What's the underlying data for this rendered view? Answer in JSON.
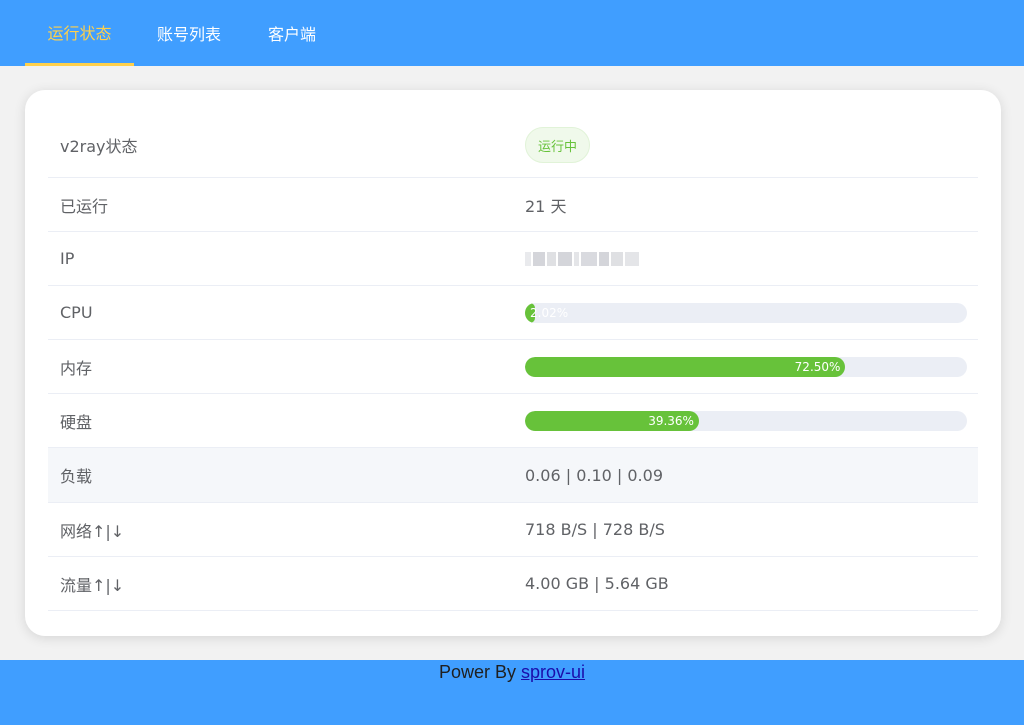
{
  "nav": {
    "items": [
      {
        "label": "运行状态"
      },
      {
        "label": "账号列表"
      },
      {
        "label": "客户端"
      }
    ],
    "active_index": 0
  },
  "status": {
    "v2ray_label": "v2ray状态",
    "v2ray_value": "运行中",
    "uptime_label": "已运行",
    "uptime_value": "21 天",
    "ip_label": "IP",
    "cpu_label": "CPU",
    "cpu_text": "2.02%",
    "cpu_percent": 2.02,
    "memory_label": "内存",
    "memory_text": "72.50%",
    "memory_percent": 72.5,
    "disk_label": "硬盘",
    "disk_text": "39.36%",
    "disk_percent": 39.36,
    "load_label": "负载",
    "load_value": "0.06 | 0.10 | 0.09",
    "network_label": "网络↑|↓",
    "network_value": "718 B/S | 728 B/S",
    "traffic_label": "流量↑|↓",
    "traffic_value": "4.00 GB | 5.64 GB"
  },
  "footer": {
    "prefix": "Power By ",
    "link_text": "sprov-ui"
  },
  "colors": {
    "header_bg": "#409eff",
    "active_nav": "#ffd04b",
    "progress_fill": "#67c23a",
    "progress_track": "#ebeef5",
    "tag_text": "#67c23a"
  }
}
